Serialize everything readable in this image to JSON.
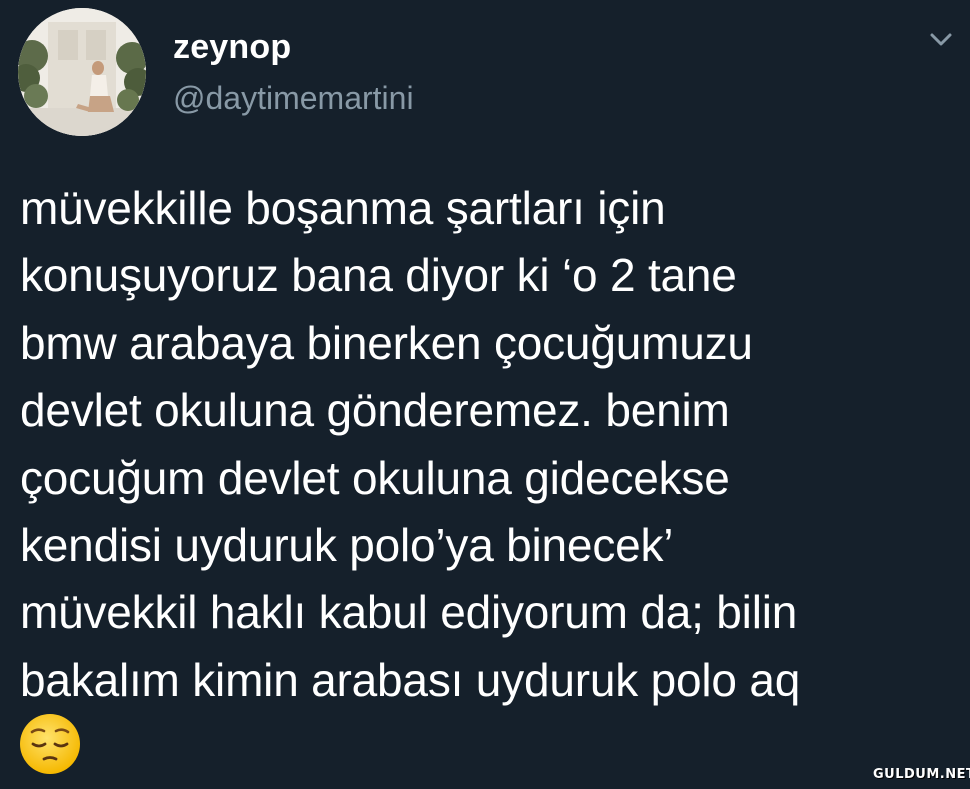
{
  "user": {
    "name": "zeynop",
    "handle": "@daytimemartini"
  },
  "tweet": {
    "text": "müvekkille boşanma şartları için\nkonuşuyoruz bana diyor ki ‘o 2 tane\nbmw arabaya binerken çocuğumuzu\ndevlet okuluna gönderemez. benim\nçocuğum devlet okuluna gidecekse\nkendisi uyduruk polo’ya binecek’\nmüvekkil haklı kabul ediyorum da; bilin\nbakalım kimin arabası uyduruk polo aq",
    "emoji": "pensive-face"
  },
  "watermark": "GULDUM.NET",
  "icons": {
    "menu": "chevron-down-icon"
  },
  "colors": {
    "background": "#15202b",
    "text": "#ffffff",
    "secondary_text": "#8899a6"
  }
}
